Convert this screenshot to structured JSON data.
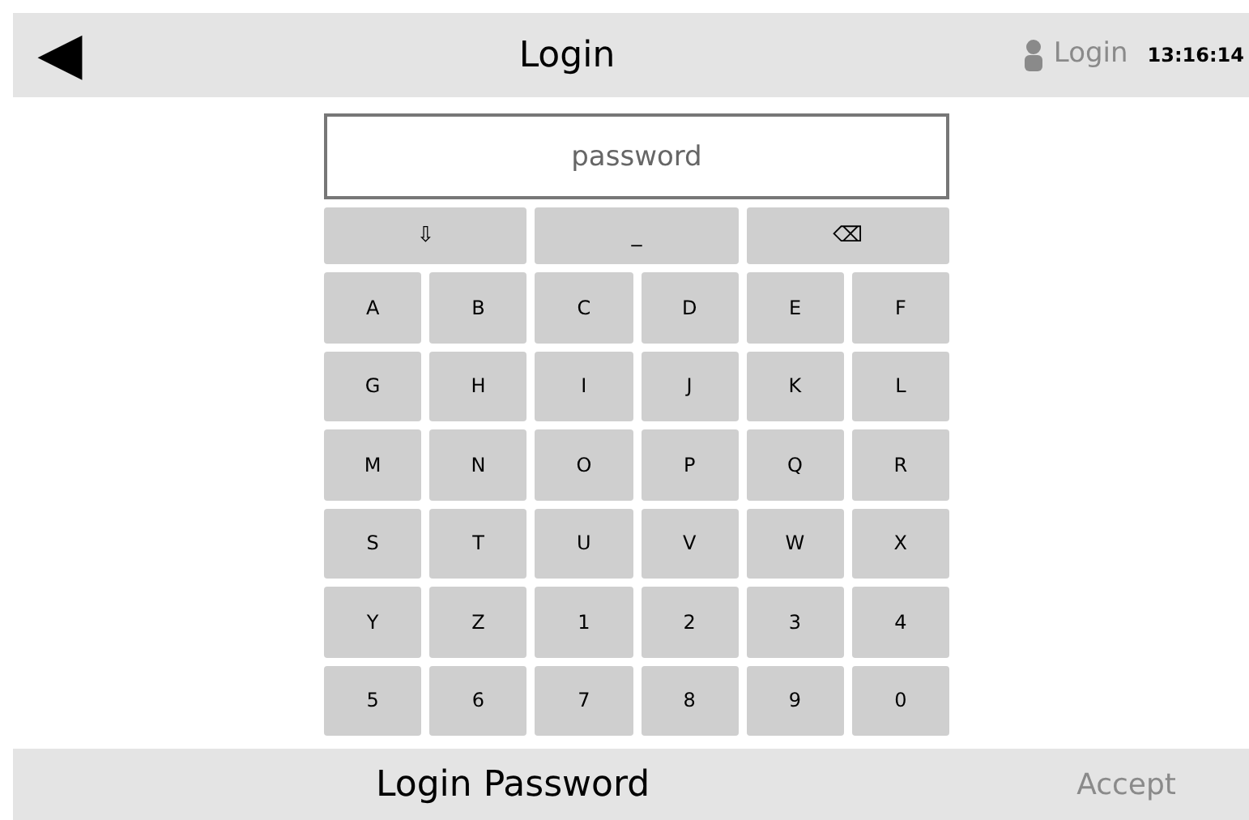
{
  "header": {
    "back": "◀",
    "title": "Login",
    "user": {
      "label": "Login",
      "disabled": true
    },
    "time": "13:16:14"
  },
  "password_field": {
    "placeholder": "password"
  },
  "special_keys": [
    "⇩",
    "_",
    "⌫"
  ],
  "keys": [
    "A",
    "B",
    "C",
    "D",
    "E",
    "F",
    "G",
    "H",
    "I",
    "J",
    "K",
    "L",
    "M",
    "N",
    "O",
    "P",
    "Q",
    "R",
    "S",
    "T",
    "U",
    "V",
    "W",
    "X",
    "Y",
    "Z",
    "1",
    "2",
    "3",
    "4",
    "5",
    "6",
    "7",
    "8",
    "9",
    "0"
  ],
  "footer": {
    "title": "Login Password",
    "accept": {
      "label": "Accept",
      "disabled": true
    }
  }
}
